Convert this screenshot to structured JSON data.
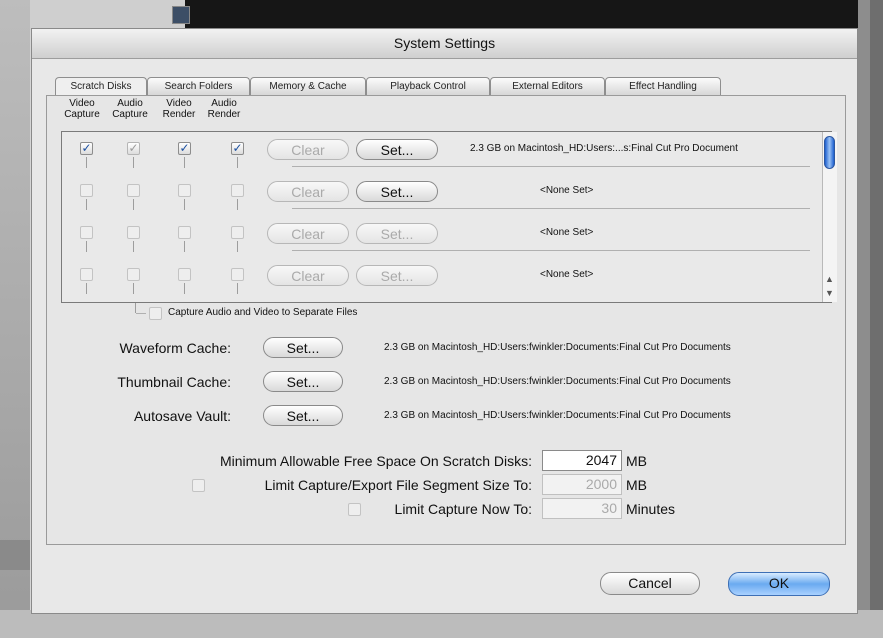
{
  "window": {
    "title": "System Settings"
  },
  "tabs": [
    {
      "label": "Scratch Disks",
      "active": true
    },
    {
      "label": "Search Folders",
      "active": false
    },
    {
      "label": "Memory & Cache",
      "active": false
    },
    {
      "label": "Playback Control",
      "active": false
    },
    {
      "label": "External Editors",
      "active": false
    },
    {
      "label": "Effect Handling",
      "active": false
    }
  ],
  "columns": [
    {
      "line1": "Video",
      "line2": "Capture"
    },
    {
      "line1": "Audio",
      "line2": "Capture"
    },
    {
      "line1": "Video",
      "line2": "Render"
    },
    {
      "line1": "Audio",
      "line2": "Render"
    }
  ],
  "scratch_rows": [
    {
      "video_capture": true,
      "audio_capture": true,
      "video_render": true,
      "audio_render": true,
      "clear_label": "Clear",
      "set_label": "Set...",
      "set_enabled": true,
      "info": "2.3 GB on  Macintosh_HD:Users:...s:Final Cut Pro Document"
    },
    {
      "video_capture": false,
      "audio_capture": false,
      "video_render": false,
      "audio_render": false,
      "clear_label": "Clear",
      "set_label": "Set...",
      "set_enabled": true,
      "info": "<None Set>"
    },
    {
      "video_capture": false,
      "audio_capture": false,
      "video_render": false,
      "audio_render": false,
      "clear_label": "Clear",
      "set_label": "Set...",
      "set_enabled": false,
      "info": "<None Set>"
    },
    {
      "video_capture": false,
      "audio_capture": false,
      "video_render": false,
      "audio_render": false,
      "clear_label": "Clear",
      "set_label": "Set...",
      "set_enabled": false,
      "info": "<None Set>"
    }
  ],
  "separate_files": {
    "label": "Capture Audio and Video to Separate Files",
    "checked": false
  },
  "caches": [
    {
      "label": "Waveform Cache:",
      "button": "Set...",
      "info": "2.3 GB on  Macintosh_HD:Users:fwinkler:Documents:Final Cut Pro Documents"
    },
    {
      "label": "Thumbnail Cache:",
      "button": "Set...",
      "info": "2.3 GB on  Macintosh_HD:Users:fwinkler:Documents:Final Cut Pro Documents"
    },
    {
      "label": "Autosave Vault:",
      "button": "Set...",
      "info": "2.3 GB on  Macintosh_HD:Users:fwinkler:Documents:Final Cut Pro Documents"
    }
  ],
  "limits": {
    "min_free": {
      "label": "Minimum Allowable Free Space On Scratch Disks:",
      "value": "2047",
      "unit": "MB"
    },
    "segment": {
      "label": "Limit Capture/Export File Segment Size To:",
      "value": "2000",
      "unit": "MB",
      "checked": false
    },
    "capture_now": {
      "label": "Limit Capture Now To:",
      "value": "30",
      "unit": "Minutes",
      "checked": false
    }
  },
  "buttons": {
    "cancel": "Cancel",
    "ok": "OK"
  },
  "colors": {
    "accent_blue": "#1c5fcf",
    "dialog_bg": "#e8e8e8"
  }
}
